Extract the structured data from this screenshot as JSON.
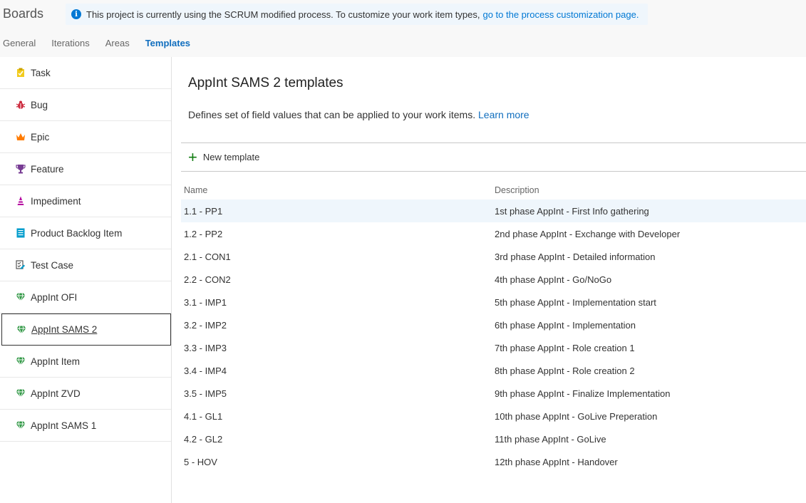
{
  "header": {
    "title": "Boards",
    "banner_text": "This project is currently using the SCRUM modified process. To customize your work item types,",
    "banner_link": "go to the process customization page."
  },
  "tabs": [
    {
      "label": "General"
    },
    {
      "label": "Iterations"
    },
    {
      "label": "Areas"
    },
    {
      "label": "Templates"
    }
  ],
  "sidebar": {
    "items": [
      {
        "label": "Task",
        "icon": "task-icon"
      },
      {
        "label": "Bug",
        "icon": "bug-icon"
      },
      {
        "label": "Epic",
        "icon": "crown-icon"
      },
      {
        "label": "Feature",
        "icon": "trophy-icon"
      },
      {
        "label": "Impediment",
        "icon": "impediment-icon"
      },
      {
        "label": "Product Backlog Item",
        "icon": "backlog-icon"
      },
      {
        "label": "Test Case",
        "icon": "test-case-icon"
      },
      {
        "label": "AppInt OFI",
        "icon": "gem-icon"
      },
      {
        "label": "AppInt SAMS 2",
        "icon": "gem-icon"
      },
      {
        "label": "AppInt Item",
        "icon": "gem-icon"
      },
      {
        "label": "AppInt ZVD",
        "icon": "gem-icon"
      },
      {
        "label": "AppInt SAMS 1",
        "icon": "gem-icon"
      }
    ]
  },
  "main": {
    "title": "AppInt SAMS 2 templates",
    "description": "Defines set of field values that can be applied to your work items.",
    "learn_more": "Learn more",
    "new_template_label": "New template"
  },
  "table": {
    "headers": {
      "name": "Name",
      "description": "Description"
    },
    "rows": [
      {
        "name": "1.1 - PP1",
        "description": "1st phase AppInt - First Info gathering"
      },
      {
        "name": "1.2 - PP2",
        "description": "2nd phase AppInt - Exchange with Developer"
      },
      {
        "name": "2.1 - CON1",
        "description": "3rd phase AppInt - Detailed information"
      },
      {
        "name": "2.2 - CON2",
        "description": "4th phase AppInt - Go/NoGo"
      },
      {
        "name": "3.1 - IMP1",
        "description": "5th phase AppInt - Implementation start"
      },
      {
        "name": "3.2 - IMP2",
        "description": "6th phase AppInt - Implementation"
      },
      {
        "name": "3.3 - IMP3",
        "description": "7th phase AppInt - Role creation 1"
      },
      {
        "name": "3.4 - IMP4",
        "description": "8th phase AppInt - Role creation 2"
      },
      {
        "name": "3.5 - IMP5",
        "description": "9th phase AppInt - Finalize Implementation"
      },
      {
        "name": "4.1 - GL1",
        "description": "10th phase AppInt - GoLive Preperation"
      },
      {
        "name": "4.2 - GL2",
        "description": "11th phase AppInt - GoLive"
      },
      {
        "name": "5 - HOV",
        "description": "12th phase AppInt - Handover"
      }
    ]
  },
  "colors": {
    "accent": "#106ebe",
    "task": "#f2cb1d",
    "bug": "#cc293d",
    "epic": "#ff7b00",
    "feature": "#773b93",
    "impediment": "#b4009e",
    "backlog": "#009ccc",
    "gem": "#339947"
  }
}
